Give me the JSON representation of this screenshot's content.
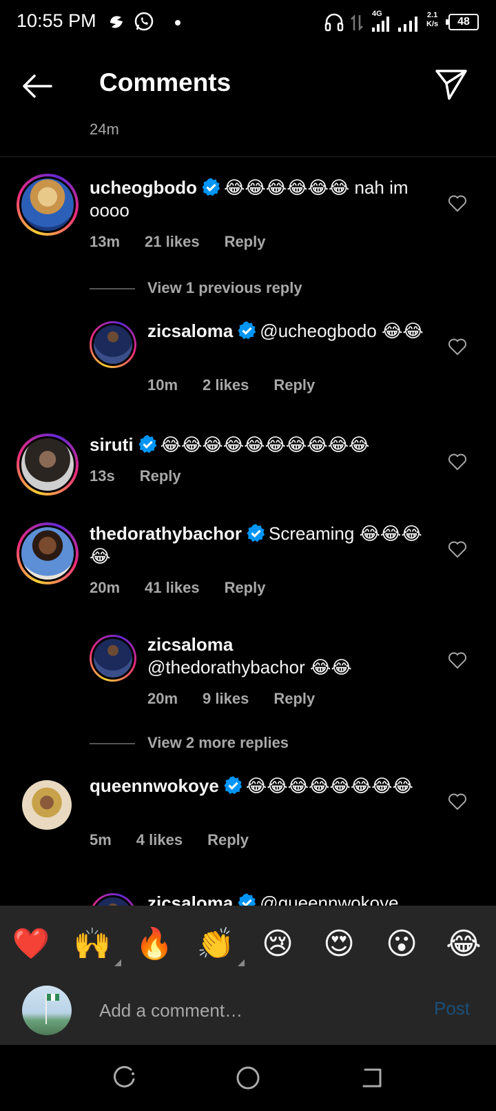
{
  "status_bar": {
    "time": "10:55 PM",
    "network": "4G",
    "speed_top": "2.1",
    "speed_bottom": "K/s",
    "battery": "48"
  },
  "header": {
    "title": "Comments"
  },
  "previous_comment": {
    "time": "24m"
  },
  "comments": [
    {
      "username": "ucheogbodo",
      "verified": true,
      "text": "😂😂😂😂😂😂 nah im oooo",
      "time": "13m",
      "likes": "21 likes",
      "reply": "Reply"
    },
    {
      "view_previous": "View 1 previous reply"
    },
    {
      "username": "zicsaloma",
      "verified": true,
      "text": "@ucheogbodo 😂😂",
      "time": "10m",
      "likes": "2 likes",
      "reply": "Reply"
    },
    {
      "username": "siruti",
      "verified": true,
      "text": "😂😂😂😂😂😂😂😂😂😂",
      "time": "13s",
      "reply": "Reply"
    },
    {
      "username": "thedorathybachor",
      "verified": true,
      "text": "Screaming 😂😂😂😂",
      "time": "20m",
      "likes": "41 likes",
      "reply": "Reply"
    },
    {
      "username": "zicsaloma",
      "verified": false,
      "text": "@thedorathybachor 😂😂",
      "time": "20m",
      "likes": "9 likes",
      "reply": "Reply"
    },
    {
      "view_more": "View 2 more replies"
    },
    {
      "username": "queennwokoye",
      "verified": true,
      "text": "😂😂😂😂😂😂😂😂",
      "time": "5m",
      "likes": "4 likes",
      "reply": "Reply"
    },
    {
      "username": "zicsaloma",
      "verified": true,
      "text": "@queennwokoye"
    }
  ],
  "reactions": [
    "❤️",
    "🙌",
    "🔥",
    "👏",
    "😢",
    "😍",
    "😮",
    "😂"
  ],
  "compose": {
    "placeholder": "Add a comment…",
    "post": "Post"
  },
  "colors": {
    "background": "#000000",
    "muted": "#a8a8a8",
    "verified": "#0095f6",
    "post_disabled": "#1a4f7a",
    "tray": "#262626"
  }
}
